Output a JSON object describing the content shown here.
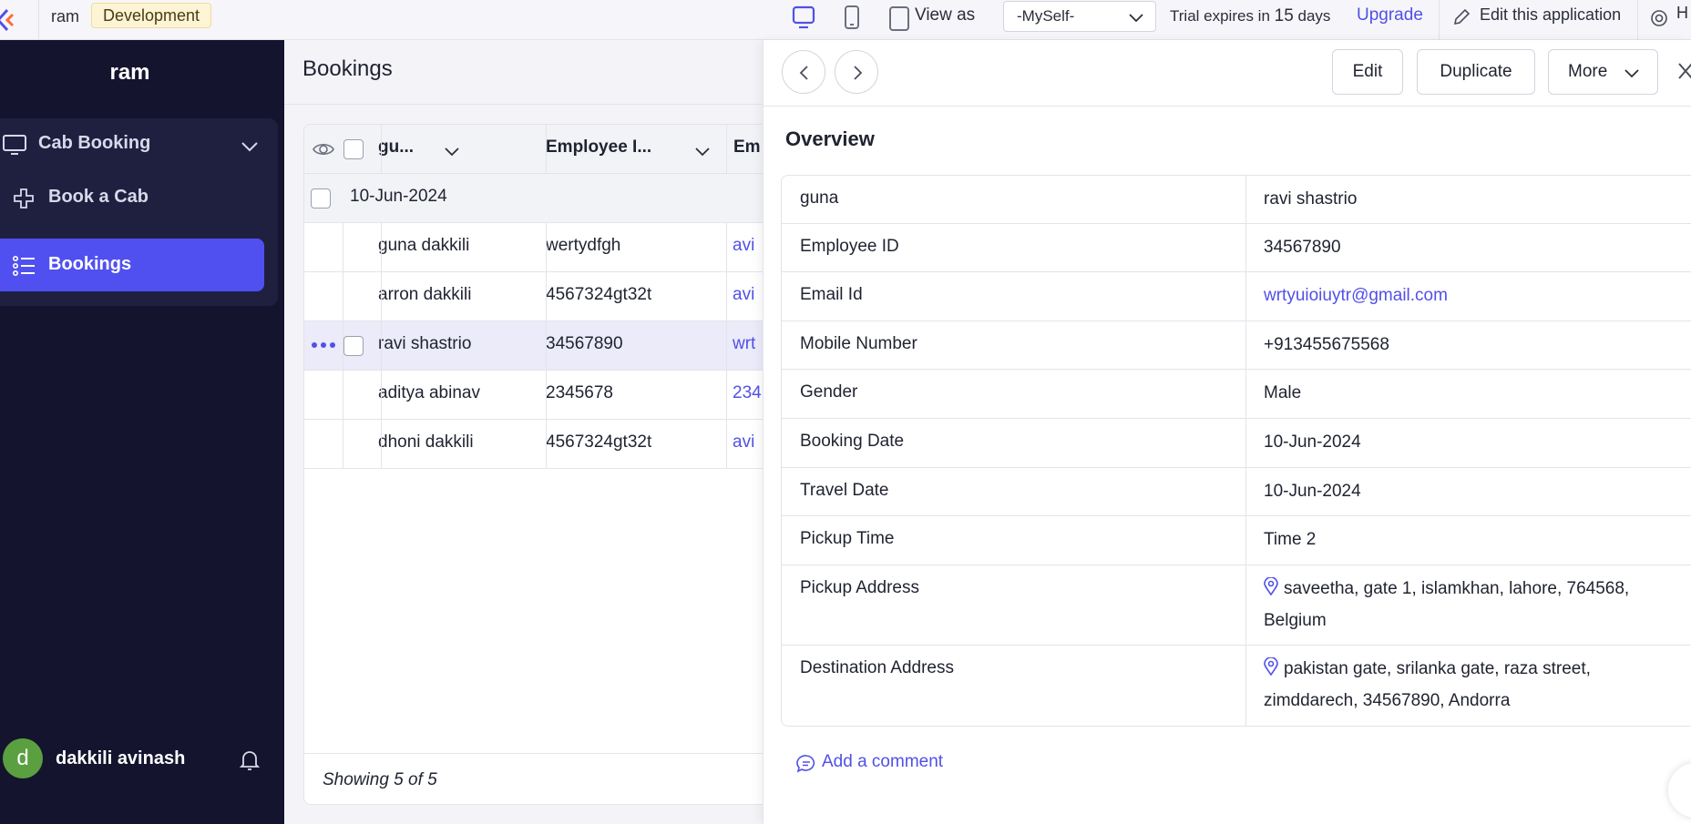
{
  "topbar": {
    "app_name": "ram",
    "environment": "Development",
    "view_as_label": "View as",
    "view_as_value": "-MySelf-",
    "trial_prefix": "Trial expires in",
    "trial_days": "15",
    "trial_suffix": "days",
    "upgrade_label": "Upgrade",
    "edit_app_label": "Edit this application",
    "help_label": "H"
  },
  "sidebar": {
    "title": "ram",
    "group_label": "Cab Booking",
    "items": [
      {
        "label": "Book a Cab",
        "icon": "plus-icon"
      },
      {
        "label": "Bookings",
        "icon": "list-icon",
        "active": true
      }
    ],
    "user_initial": "d",
    "user_name": "dakkili avinash"
  },
  "list": {
    "page_title": "Bookings",
    "columns": [
      "gu...",
      "Employee I...",
      "Em"
    ],
    "group_label": "10-Jun-2024",
    "rows": [
      {
        "name": "guna dakkili",
        "employee_id": "wertydfgh",
        "email": "avi"
      },
      {
        "name": "arron dakkili",
        "employee_id": "4567324gt32t",
        "email": "avi"
      },
      {
        "name": "ravi shastrio",
        "employee_id": "34567890",
        "email": "wrt"
      },
      {
        "name": "aditya abinav",
        "employee_id": "2345678",
        "email": "234"
      },
      {
        "name": "dhoni dakkili",
        "employee_id": "4567324gt32t",
        "email": "avi"
      }
    ],
    "footer": "Showing 5 of 5"
  },
  "detail": {
    "edit_label": "Edit",
    "duplicate_label": "Duplicate",
    "more_label": "More",
    "overview_title": "Overview",
    "fields": [
      {
        "label": "guna",
        "value": "ravi shastrio"
      },
      {
        "label": "Employee ID",
        "value": "34567890"
      },
      {
        "label": "Email Id",
        "value": "wrtyuioiuytr@gmail.com"
      },
      {
        "label": "Mobile Number",
        "value": "+913455675568"
      },
      {
        "label": "Gender",
        "value": "Male"
      },
      {
        "label": "Booking Date",
        "value": "10-Jun-2024"
      },
      {
        "label": "Travel Date",
        "value": "10-Jun-2024"
      },
      {
        "label": "Pickup Time",
        "value": "Time 2"
      },
      {
        "label": "Pickup Address",
        "value": "saveetha, gate 1, islamkhan, lahore, 764568, Belgium"
      },
      {
        "label": "Destination Address",
        "value": "pakistan gate, srilanka gate, raza street, zimddarech, 34567890, Andorra"
      }
    ],
    "add_comment_label": "Add a comment"
  },
  "colors": {
    "accent": "#5150e6",
    "sidebar_bg": "#14142e",
    "active_nav": "#5050f0",
    "avatar": "#5aa040"
  }
}
